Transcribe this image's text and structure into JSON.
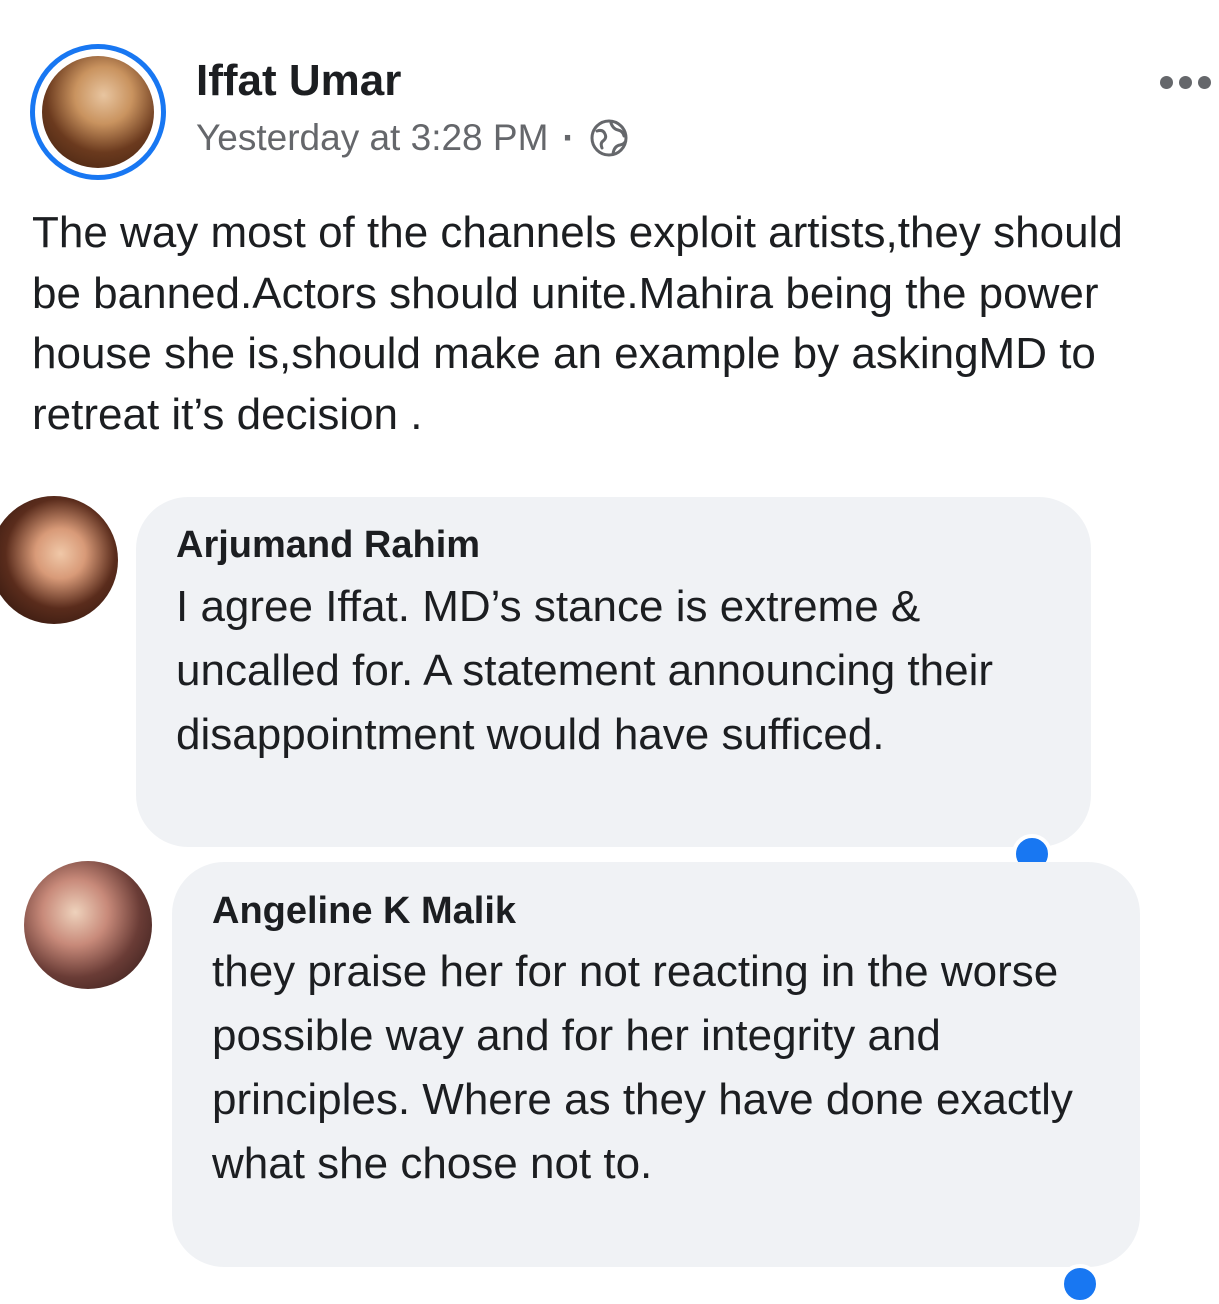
{
  "post": {
    "author": "Iffat Umar",
    "timestamp": "Yesterday at 3:28 PM",
    "separator": "·",
    "privacy_icon": "globe-icon",
    "more_icon": "more-options-icon",
    "text": "The way most of the channels exploit artists,they should be banned.Actors should unite.Mahira being the power house she is,should make an example by askingMD to retreat it’s decision ."
  },
  "comments": [
    {
      "author": "Arjumand Rahim",
      "text": "I agree Iffat. MD’s stance is extreme & uncalled for. A statement announcing their disappointment would have sufficed."
    },
    {
      "author": "Angeline K Malik",
      "text": "they praise her for not reacting in the worse possible way and for her integrity and principles. Where as they have done exactly what she chose not to."
    }
  ],
  "colors": {
    "accent": "#1877f2",
    "bubble": "#f0f2f5",
    "secondary_text": "#65676b",
    "primary_text": "#1c1e21"
  }
}
